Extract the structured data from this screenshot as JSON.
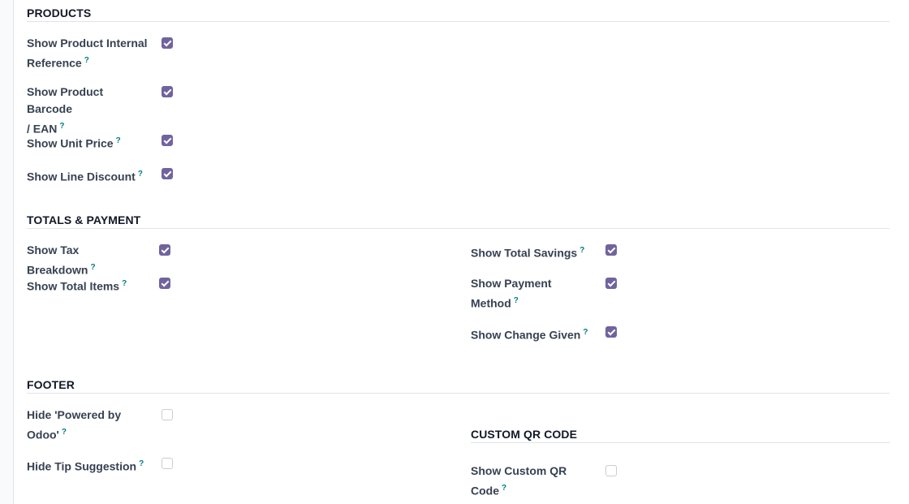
{
  "colors": {
    "accent": "#71639e",
    "help": "#017e84"
  },
  "products": {
    "title": "PRODUCTS",
    "items": [
      {
        "line1": "Show Product Internal",
        "line2": "Reference",
        "checked": true
      },
      {
        "line1": "Show Product Barcode",
        "line2": "/ EAN",
        "checked": true
      },
      {
        "line1": "Show Unit Price",
        "line2": "",
        "checked": true
      },
      {
        "line1": "Show Line Discount",
        "line2": "",
        "checked": true
      }
    ]
  },
  "totals": {
    "title": "TOTALS & PAYMENT",
    "left": [
      {
        "line1": "Show Tax Breakdown",
        "line2": "",
        "checked": true
      },
      {
        "line1": "Show Total Items",
        "line2": "",
        "checked": true
      }
    ],
    "right": [
      {
        "line1": "Show Total Savings",
        "line2": "",
        "checked": true
      },
      {
        "line1": "Show Payment",
        "line2": "Method",
        "checked": true
      },
      {
        "line1": "Show Change Given",
        "line2": "",
        "checked": true
      }
    ]
  },
  "footer": {
    "title": "FOOTER",
    "items": [
      {
        "line1": "Hide 'Powered by",
        "line2": "Odoo'",
        "checked": false
      },
      {
        "line1": "Hide Tip Suggestion",
        "line2": "",
        "checked": false
      }
    ]
  },
  "qr": {
    "title": "CUSTOM QR CODE",
    "items": [
      {
        "line1": "Show Custom QR",
        "line2": "Code",
        "checked": false
      }
    ]
  },
  "help_mark": "?"
}
